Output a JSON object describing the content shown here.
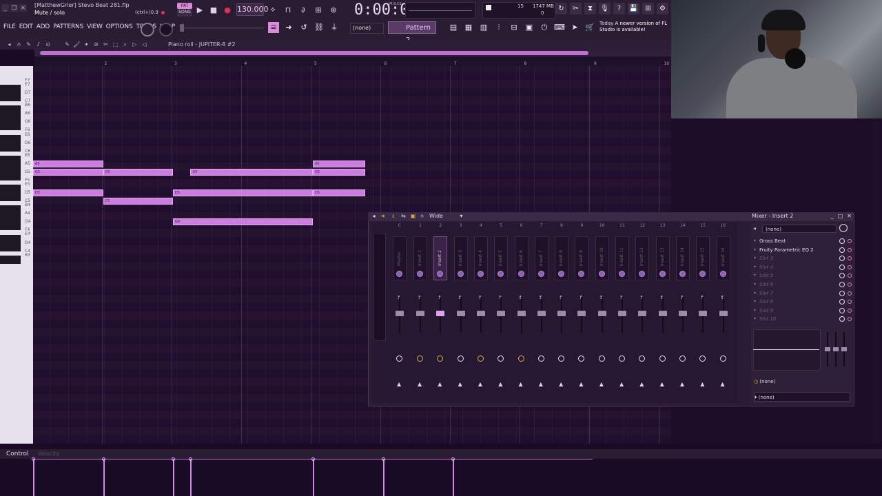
{
  "titlebar": {
    "title": "[MatthewGrier] Stevo Beat 281.flp",
    "hint": "Mute / solo",
    "shortcut": "(ctrl+)0.9",
    "pat_label": "PAT",
    "song_label": "SONG",
    "tempo": "130.000",
    "time": "0:00:00",
    "time_unit": "M:S:CS",
    "cpu_value": "15",
    "memory": "1747 MB",
    "polyphony": "0"
  },
  "menu": [
    "FILE",
    "EDIT",
    "ADD",
    "PATTERNS",
    "VIEW",
    "OPTIONS",
    "TOOLS",
    "HELP"
  ],
  "toolbar": {
    "snap_value": "(none)",
    "pattern": "Pattern 2"
  },
  "news": {
    "day": "Today",
    "text": "A newer version of FL Studio is available!"
  },
  "piano_roll": {
    "title": "Piano roll - JUPITER-8 #2",
    "bar_numbers": [
      "2",
      "3",
      "4",
      "5",
      "6",
      "7",
      "8",
      "9",
      "10"
    ],
    "key_labels": [
      "F7",
      "E7",
      "D7",
      "C7",
      "B6",
      "A6",
      "G6",
      "F6",
      "E6",
      "D6",
      "C6",
      "B5",
      "A5",
      "G5",
      "F5",
      "E5",
      "D5",
      "C5",
      "B4",
      "A4",
      "G4",
      "F4",
      "E4",
      "D4",
      "C4",
      "B3"
    ],
    "notes": [
      {
        "label": "A5",
        "pitch": "A5",
        "start": 1.0,
        "length": 1.0
      },
      {
        "label": "A5",
        "pitch": "A5",
        "start": 5.0,
        "length": 0.75
      },
      {
        "label": "G5",
        "pitch": "G5",
        "start": 1.0,
        "length": 1.0
      },
      {
        "label": "G5",
        "pitch": "G5",
        "start": 2.0,
        "length": 1.0
      },
      {
        "label": "G5",
        "pitch": "G5",
        "start": 3.25,
        "length": 1.75
      },
      {
        "label": "G5",
        "pitch": "G5",
        "start": 5.0,
        "length": 0.75
      },
      {
        "label": "D5",
        "pitch": "D5",
        "start": 1.0,
        "length": 1.0
      },
      {
        "label": "D5",
        "pitch": "D5",
        "start": 3.0,
        "length": 2.0
      },
      {
        "label": "D5",
        "pitch": "D5",
        "start": 5.0,
        "length": 0.75
      },
      {
        "label": "C5",
        "pitch": "C5",
        "start": 2.0,
        "length": 1.0
      },
      {
        "label": "G4",
        "pitch": "G4",
        "start": 3.0,
        "length": 2.0
      }
    ]
  },
  "control": {
    "label": "Control",
    "parameter": "Velocity",
    "velocity_positions": [
      1.0,
      2.0,
      3.0,
      3.25,
      5.0,
      6.0,
      7.0
    ]
  },
  "mixer": {
    "view_label": "Wide",
    "title": "Mixer - Insert 2",
    "tracks": [
      {
        "num": "C",
        "name": "Master",
        "selected": false,
        "route": "white"
      },
      {
        "num": "1",
        "name": "Insert 1",
        "selected": false,
        "route": "yellow"
      },
      {
        "num": "2",
        "name": "Insert 2",
        "selected": true,
        "route": "yellow"
      },
      {
        "num": "3",
        "name": "Insert 3",
        "selected": false,
        "route": "white"
      },
      {
        "num": "4",
        "name": "Insert 4",
        "selected": false,
        "route": "yellow"
      },
      {
        "num": "5",
        "name": "Insert 5",
        "selected": false,
        "route": "white"
      },
      {
        "num": "6",
        "name": "Insert 6",
        "selected": false,
        "route": "yellow"
      },
      {
        "num": "7",
        "name": "Insert 7",
        "selected": false,
        "route": "white"
      },
      {
        "num": "8",
        "name": "Insert 8",
        "selected": false,
        "route": "white"
      },
      {
        "num": "9",
        "name": "Insert 9",
        "selected": false,
        "route": "white"
      },
      {
        "num": "10",
        "name": "Insert 10",
        "selected": false,
        "route": "white"
      },
      {
        "num": "11",
        "name": "Insert 11",
        "selected": false,
        "route": "white"
      },
      {
        "num": "12",
        "name": "Insert 12",
        "selected": false,
        "route": "white"
      },
      {
        "num": "13",
        "name": "Insert 13",
        "selected": false,
        "route": "white"
      },
      {
        "num": "14",
        "name": "Insert 14",
        "selected": false,
        "route": "white"
      },
      {
        "num": "15",
        "name": "Insert 15",
        "selected": false,
        "route": "white"
      },
      {
        "num": "16",
        "name": "Insert 16",
        "selected": false,
        "route": "white"
      }
    ],
    "insert_preset": "(none)",
    "slots": [
      {
        "name": "Gross Beat",
        "filled": true
      },
      {
        "name": "Fruity Parametric EQ 2",
        "filled": true
      },
      {
        "name": "Slot 3",
        "filled": false
      },
      {
        "name": "Slot 4",
        "filled": false
      },
      {
        "name": "Slot 5",
        "filled": false
      },
      {
        "name": "Slot 6",
        "filled": false
      },
      {
        "name": "Slot 7",
        "filled": false
      },
      {
        "name": "Slot 8",
        "filled": false
      },
      {
        "name": "Slot 9",
        "filled": false
      },
      {
        "name": "Slot 10",
        "filled": false
      }
    ],
    "input": "(none)",
    "output": "(none)"
  }
}
